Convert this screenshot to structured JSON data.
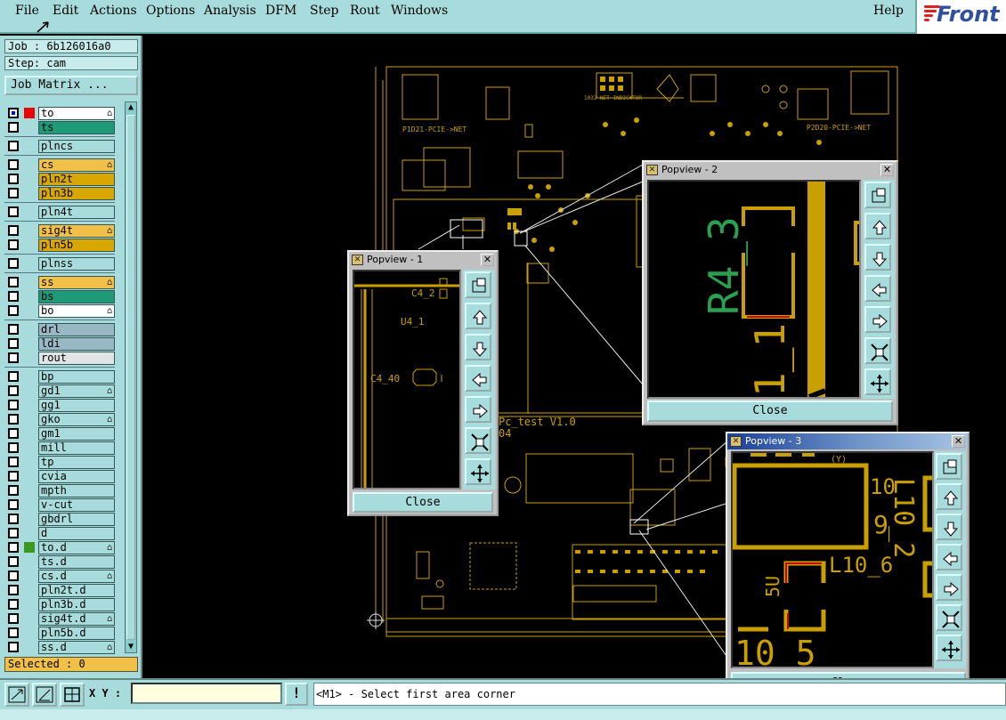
{
  "menu": {
    "file": "File",
    "edit": "Edit",
    "actions": "Actions",
    "options": "Options",
    "analysis": "Analysis",
    "dfm": "DFM",
    "step": "Step",
    "rout": "Rout",
    "windows": "Windows",
    "help": "Help"
  },
  "logo_text": "Front",
  "job_label": "Job : 6b126016a0",
  "step_label": "Step: cam",
  "job_matrix_button": "Job Matrix ...",
  "layers": [
    {
      "name": "to",
      "color": "#ffffff",
      "flag": "⌂"
    },
    {
      "name": "ts",
      "color": "#1e9a78",
      "flag": ""
    },
    {
      "name": "plncs",
      "color": "#a8dcdc",
      "flag": ""
    },
    {
      "name": "cs",
      "color": "#f0c048",
      "flag": "⌂"
    },
    {
      "name": "pln2t",
      "color": "#d9a800",
      "flag": ""
    },
    {
      "name": "pln3b",
      "color": "#d9a800",
      "flag": ""
    },
    {
      "name": "pln4t",
      "color": "#a8dcdc",
      "flag": ""
    },
    {
      "name": "sig4t",
      "color": "#f0c048",
      "flag": "⌂"
    },
    {
      "name": "pln5b",
      "color": "#d9a800",
      "flag": ""
    },
    {
      "name": "plnss",
      "color": "#a8dcdc",
      "flag": ""
    },
    {
      "name": "ss",
      "color": "#f0c048",
      "flag": "⌂"
    },
    {
      "name": "bs",
      "color": "#1e9a78",
      "flag": ""
    },
    {
      "name": "bo",
      "color": "#ffffff",
      "flag": "⌂"
    },
    {
      "name": "drl",
      "color": "#98b8c4",
      "flag": ""
    },
    {
      "name": "ldi",
      "color": "#98b8c4",
      "flag": ""
    },
    {
      "name": "rout",
      "color": "#e0e4e4",
      "flag": ""
    },
    {
      "name": "bp",
      "color": "#a8dcdc",
      "flag": ""
    },
    {
      "name": "gd1",
      "color": "#a8dcdc",
      "flag": "⌂"
    },
    {
      "name": "gg1",
      "color": "#a8dcdc",
      "flag": ""
    },
    {
      "name": "gko",
      "color": "#a8dcdc",
      "flag": "⌂"
    },
    {
      "name": "gm1",
      "color": "#a8dcdc",
      "flag": ""
    },
    {
      "name": "mill",
      "color": "#a8dcdc",
      "flag": ""
    },
    {
      "name": "tp",
      "color": "#a8dcdc",
      "flag": ""
    },
    {
      "name": "cvia",
      "color": "#a8dcdc",
      "flag": ""
    },
    {
      "name": "mpth",
      "color": "#a8dcdc",
      "flag": ""
    },
    {
      "name": "v-cut",
      "color": "#a8dcdc",
      "flag": ""
    },
    {
      "name": "gbdrl",
      "color": "#a8dcdc",
      "flag": ""
    },
    {
      "name": "d",
      "color": "#a8dcdc",
      "flag": ""
    },
    {
      "name": "to.d",
      "color": "#a8dcdc",
      "flag": "⌂"
    },
    {
      "name": "ts.d",
      "color": "#a8dcdc",
      "flag": ""
    },
    {
      "name": "cs.d",
      "color": "#a8dcdc",
      "flag": "⌂"
    },
    {
      "name": "pln2t.d",
      "color": "#a8dcdc",
      "flag": ""
    },
    {
      "name": "pln3b.d",
      "color": "#a8dcdc",
      "flag": ""
    },
    {
      "name": "sig4t.d",
      "color": "#a8dcdc",
      "flag": "⌂"
    },
    {
      "name": "pln5b.d",
      "color": "#a8dcdc",
      "flag": ""
    },
    {
      "name": "ss.d",
      "color": "#a8dcdc",
      "flag": "⌂"
    }
  ],
  "selected_label": "Selected : 0",
  "xy_label": "X Y :",
  "xy_value": "",
  "status_message": "<M1> - Select first area corner",
  "popup1": {
    "title": "Popview - 1",
    "close": "Close",
    "labels": [
      "C4_2",
      "U4_1",
      "C4_40"
    ]
  },
  "popup2": {
    "title": "Popview - 2",
    "close": "Close",
    "labels": [
      "R4_3"
    ]
  },
  "popup3": {
    "title": "Popview - 3",
    "close": "Close",
    "labels": [
      "10",
      "L10_2",
      "9",
      "5U",
      "L10_6",
      "10_5"
    ]
  },
  "pcb_labels": {
    "a": "P1D21-PCIE->NET",
    "b": "P2D20-PCIE->NET",
    "c": "Pc_test V1.0",
    "d": "04",
    "e": "1032-NET-INDICATOR"
  }
}
